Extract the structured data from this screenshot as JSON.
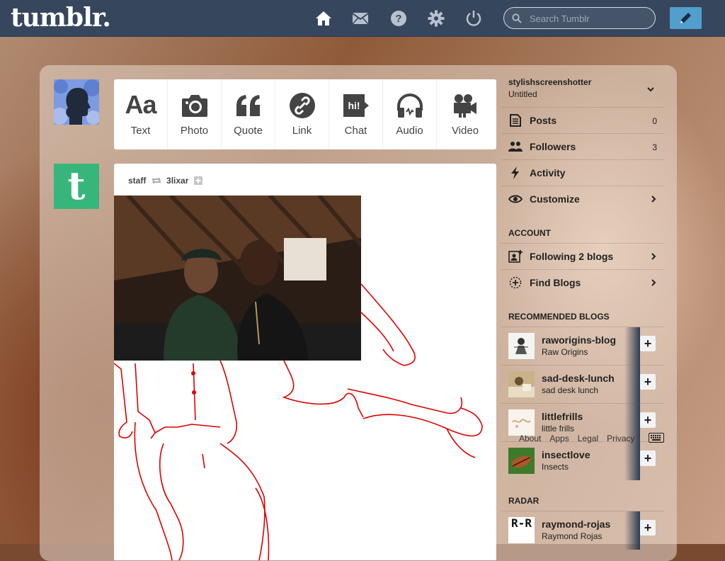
{
  "header": {
    "logo": "tumblr.",
    "search_placeholder": "Search Tumblr"
  },
  "post_types": [
    {
      "label": "Text",
      "icon": "text-icon",
      "glyph": "Aa"
    },
    {
      "label": "Photo",
      "icon": "camera-icon"
    },
    {
      "label": "Quote",
      "icon": "quote-icon"
    },
    {
      "label": "Link",
      "icon": "link-icon"
    },
    {
      "label": "Chat",
      "icon": "chat-icon",
      "glyph": "hi!"
    },
    {
      "label": "Audio",
      "icon": "headphones-icon"
    },
    {
      "label": "Video",
      "icon": "video-camera-icon"
    }
  ],
  "post": {
    "author": "staff",
    "reblogged_from": "3lixar"
  },
  "account": {
    "name": "stylishscreenshotter",
    "title": "Untitled",
    "items": [
      {
        "label": "Posts",
        "count": "0"
      },
      {
        "label": "Followers",
        "count": "3"
      },
      {
        "label": "Activity"
      },
      {
        "label": "Customize"
      }
    ]
  },
  "account_section": {
    "heading": "ACCOUNT",
    "items": [
      {
        "label": "Following 2 blogs"
      },
      {
        "label": "Find Blogs"
      }
    ]
  },
  "recommended": {
    "heading": "RECOMMENDED BLOGS",
    "blogs": [
      {
        "name": "raworigins-blog",
        "title": "Raw Origins"
      },
      {
        "name": "sad-desk-lunch",
        "title": "sad desk lunch"
      },
      {
        "name": "littlefrills",
        "title": "little frills"
      },
      {
        "name": "insectlove",
        "title": "Insects"
      }
    ]
  },
  "radar": {
    "heading": "RADAR",
    "blog": {
      "name": "raymond-rojas",
      "title": "Raymond Rojas",
      "logo_text": "R-R"
    }
  },
  "footer": {
    "links": [
      "About",
      "Apps",
      "Legal",
      "Privacy"
    ]
  },
  "colors": {
    "topbar": "#36465d",
    "compose": "#529ecc",
    "drawing": "#e00000"
  }
}
